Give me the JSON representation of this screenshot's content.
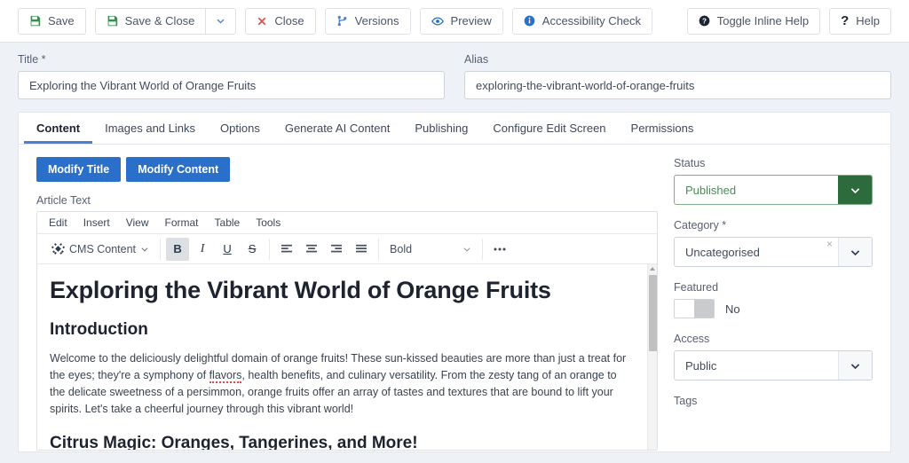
{
  "toolbar": {
    "buttons": [
      {
        "label": "Save",
        "icon": "save-icon"
      },
      {
        "label": "Save & Close",
        "icon": "save-icon"
      },
      {
        "label": "Close",
        "icon": "close-x-icon"
      },
      {
        "label": "Versions",
        "icon": "code-branch-icon"
      },
      {
        "label": "Preview",
        "icon": "eye-icon"
      },
      {
        "label": "Accessibility Check",
        "icon": "info-circle-icon"
      },
      {
        "label": "Toggle Inline Help",
        "icon": "question-circle-icon"
      },
      {
        "label": "Help",
        "icon": "question-mark-icon"
      }
    ],
    "save_dropdown_icon": "chevron-down-icon"
  },
  "fields": {
    "title": {
      "label": "Title *",
      "value": "Exploring the Vibrant World of Orange Fruits",
      "placeholder": "Title"
    },
    "alias": {
      "label": "Alias",
      "value": "exploring-the-vibrant-world-of-orange-fruits",
      "placeholder": "Alias"
    }
  },
  "tabs": [
    {
      "label": "Content",
      "active": true
    },
    {
      "label": "Images and Links",
      "active": false
    },
    {
      "label": "Options",
      "active": false
    },
    {
      "label": "Generate AI Content",
      "active": false
    },
    {
      "label": "Publishing",
      "active": false
    },
    {
      "label": "Configure Edit Screen",
      "active": false
    },
    {
      "label": "Permissions",
      "active": false
    }
  ],
  "ai_buttons": [
    {
      "label": "Modify Title"
    },
    {
      "label": "Modify Content"
    }
  ],
  "editor": {
    "section_label": "Article Text",
    "menu": [
      "Edit",
      "Insert",
      "View",
      "Format",
      "Table",
      "Tools"
    ],
    "plugin_button": {
      "label": "CMS Content",
      "icon": "joomla-icon",
      "caret": "chevron-down-icon"
    },
    "format_buttons": [
      {
        "name": "bold-button",
        "glyph": "B",
        "active": true
      },
      {
        "name": "italic-button",
        "glyph": "I",
        "active": false
      },
      {
        "name": "underline-button",
        "glyph": "U",
        "active": false
      },
      {
        "name": "strikethrough-button",
        "glyph": "S",
        "active": false
      }
    ],
    "align_buttons": [
      "align-left-button",
      "align-center-button",
      "align-right-button",
      "align-justify-button"
    ],
    "style_select": {
      "value": "Bold",
      "caret": "chevron-down-icon"
    },
    "overflow_button": "more-options-icon",
    "content": {
      "h1": "Exploring the Vibrant World of Orange Fruits",
      "h2_intro": "Introduction",
      "paragraph_1_a": "Welcome to the deliciously delightful domain of orange fruits! These sun-kissed beauties are more than just a treat for the eyes; they're a symphony of ",
      "paragraph_1_misspelled": "flavors",
      "paragraph_1_b": ", health benefits, and culinary versatility. From the zesty tang of an orange to the delicate sweetness of a persimmon, orange fruits offer an array of tastes and textures that are bound to lift your spirits. Let's take a cheerful journey through this vibrant world!",
      "h2_citrus": "Citrus Magic: Oranges, Tangerines, and More!"
    }
  },
  "sidebar": {
    "status": {
      "label": "Status",
      "value": "Published",
      "caret": "chevron-down-icon"
    },
    "category": {
      "label": "Category *",
      "value": "Uncategorised",
      "clear": "×",
      "caret": "chevron-down-icon"
    },
    "featured": {
      "label": "Featured",
      "value": "No",
      "state": "off"
    },
    "access": {
      "label": "Access",
      "value": "Public",
      "caret": "chevron-down-icon"
    },
    "tags": {
      "label": "Tags"
    }
  },
  "colors": {
    "accent_blue": "#2a6fc9",
    "save_green": "#3a8f4f",
    "close_red": "#d9534f",
    "status_green": "#2e6b3c",
    "page_bg": "#eef2f6"
  }
}
